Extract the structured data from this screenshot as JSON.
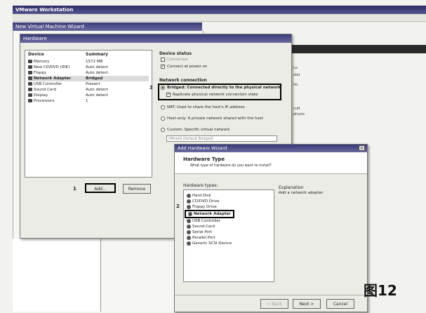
{
  "vmware": {
    "title": "VMware Workstation",
    "side_text": [
      "Lo",
      "ster",
      "ho",
      "cuft",
      "physis"
    ]
  },
  "new_vm_wizard": {
    "title": "New Virtual Machine Wizard"
  },
  "hardware_dialog": {
    "title": "Hardware",
    "columns": {
      "device": "Device",
      "summary": "Summary"
    },
    "devices": [
      {
        "device": "Memory",
        "summary": "1572 MB"
      },
      {
        "device": "New CD/DVD (IDE)",
        "summary": "Auto detect"
      },
      {
        "device": "Floppy",
        "summary": "Auto detect"
      },
      {
        "device": "Network Adapter",
        "summary": "Bridged"
      },
      {
        "device": "USB Controller",
        "summary": "Present"
      },
      {
        "device": "Sound Card",
        "summary": "Auto detect"
      },
      {
        "device": "Display",
        "summary": "Auto detect"
      },
      {
        "device": "Processors",
        "summary": "1"
      }
    ],
    "device_status_label": "Device status",
    "connected_label": "Connected",
    "connect_power_on_label": "Connect at power on",
    "network_connection_label": "Network connection",
    "bridged_label": "Bridged: Connected directly to the physical network",
    "replicate_label": "Replicate physical network connection state",
    "nat_label": "NAT: Used to share the host's IP address",
    "hostonly_label": "Host-only: A private network shared with the host",
    "custom_label": "Custom: Specific virtual network",
    "custom_select": "VMnet0 (Default Bridged)",
    "add_button": "Add...",
    "remove_button": "Remove",
    "marker_1": "1",
    "marker_3": "3"
  },
  "add_hardware_wizard": {
    "title": "Add Hardware Wizard",
    "header_title": "Hardware Type",
    "header_subtitle": "What type of hardware do you want to install?",
    "hardware_types_label": "Hardware types:",
    "explanation_label": "Explanation",
    "explanation_text": "Add a network adapter.",
    "hardware_types": [
      "Hard Disk",
      "CD/DVD Drive",
      "Floppy Drive",
      "Network Adapter",
      "USB Controller",
      "Sound Card",
      "Serial Port",
      "Parallel Port",
      "Generic SCSI Device"
    ],
    "back_button": "< Back",
    "next_button": "Next >",
    "cancel_button": "Cancel",
    "marker_2": "2"
  },
  "figure_label": "图12"
}
